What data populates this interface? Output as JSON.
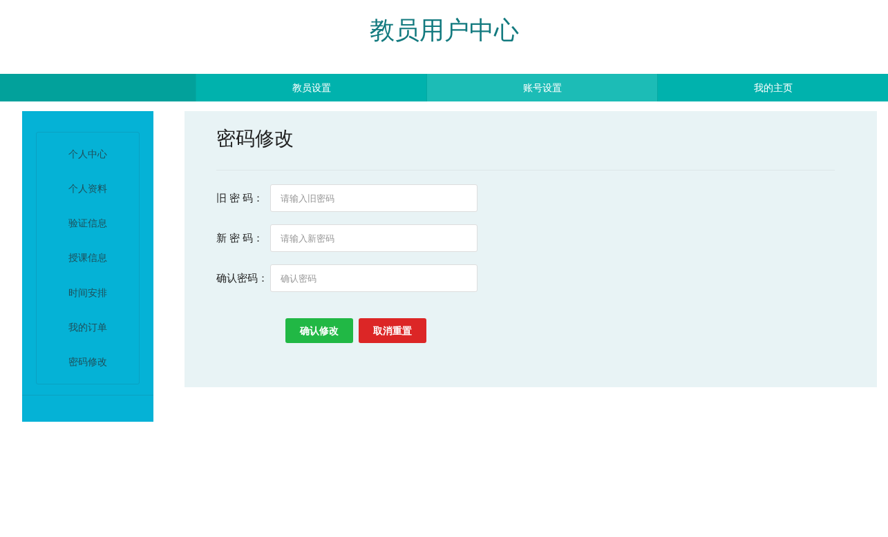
{
  "header": {
    "title": "教员用户中心"
  },
  "nav": [
    {
      "label": "教员设置",
      "selected": false
    },
    {
      "label": "账号设置",
      "selected": true
    },
    {
      "label": "我的主页",
      "selected": false
    }
  ],
  "sidebar": {
    "items": [
      {
        "label": "个人中心"
      },
      {
        "label": "个人资料"
      },
      {
        "label": "验证信息"
      },
      {
        "label": "授课信息"
      },
      {
        "label": "时间安排"
      },
      {
        "label": "我的订单"
      },
      {
        "label": "密码修改"
      }
    ]
  },
  "form": {
    "title": "密码修改",
    "fields": [
      {
        "label": "旧 密 码：",
        "placeholder": "请输入旧密码"
      },
      {
        "label": "新 密 码：",
        "placeholder": "请输入新密码"
      },
      {
        "label": "确认密码：",
        "placeholder": "确认密码"
      }
    ],
    "buttons": [
      {
        "label": "确认修改",
        "kind": "confirm"
      },
      {
        "label": "取消重置",
        "kind": "cancel"
      }
    ]
  }
}
